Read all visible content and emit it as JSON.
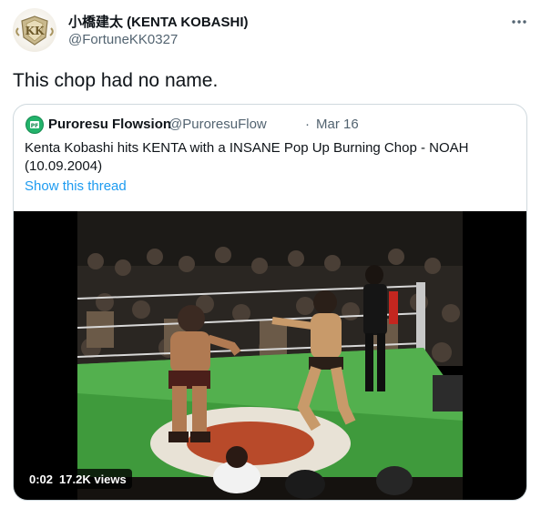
{
  "tweet": {
    "author_name": "小橋建太 (KENTA KOBASHI)",
    "author_handle": "@FortuneKK0327",
    "avatar_icon": "kobashi-logo-icon",
    "more_icon": "more-options-icon",
    "text": "This chop had no name."
  },
  "quoted_tweet": {
    "author_name": "Puroresu Flowsion",
    "author_handle": "@PuroresuFlow",
    "separator": "·",
    "date": "Mar 16",
    "text": "Kenta Kobashi hits KENTA with a INSANE Pop Up Burning Chop - NOAH (10.09.2004)",
    "show_thread": "Show this thread",
    "link_color": "#1d9bf0",
    "video": {
      "time": "0:02",
      "views": "17.2K views"
    }
  }
}
